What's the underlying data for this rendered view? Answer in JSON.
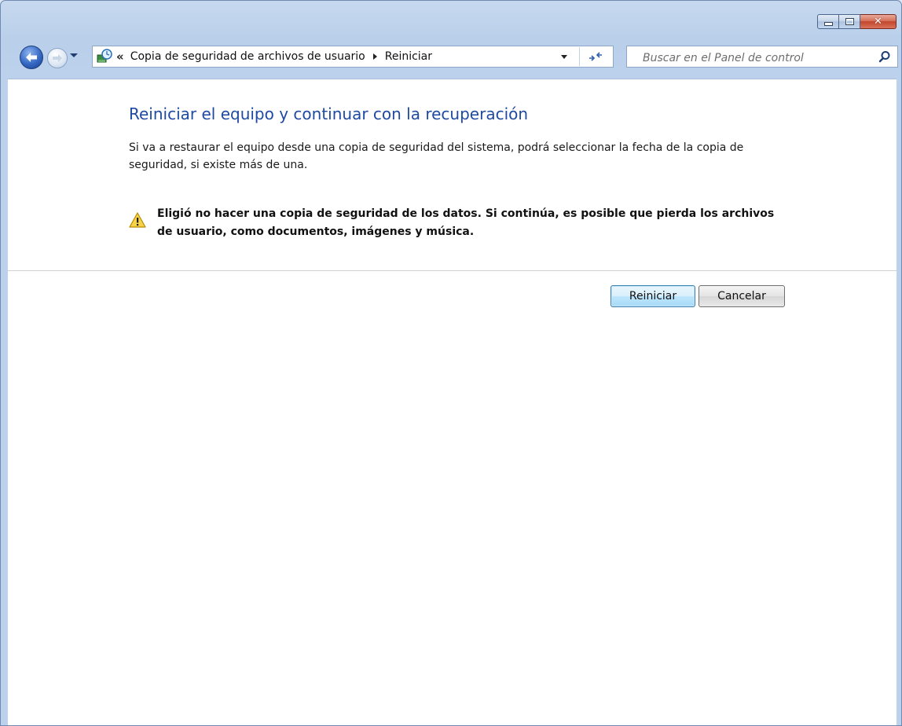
{
  "window": {
    "accent": "#1e4aa1",
    "caption_buttons": [
      "minimize-icon",
      "maximize-icon",
      "close-icon"
    ]
  },
  "navigation": {
    "breadcrumb_overflow": "«",
    "breadcrumb": [
      {
        "label": "Copia de seguridad de archivos de usuario"
      },
      {
        "label": "Reiniciar"
      }
    ],
    "search_placeholder": "Buscar en el Panel de control"
  },
  "main": {
    "title": "Reiniciar el equipo y continuar con la recuperación",
    "description": "Si va a restaurar el equipo desde una copia de seguridad del sistema, podrá seleccionar la fecha de la copia de seguridad, si existe más de una.",
    "warning": "Eligió no hacer una copia de seguridad de los datos. Si continúa, es posible que pierda los archivos de usuario, como documentos, imágenes y música."
  },
  "buttons": {
    "restart": "Reiniciar",
    "cancel": "Cancelar"
  }
}
